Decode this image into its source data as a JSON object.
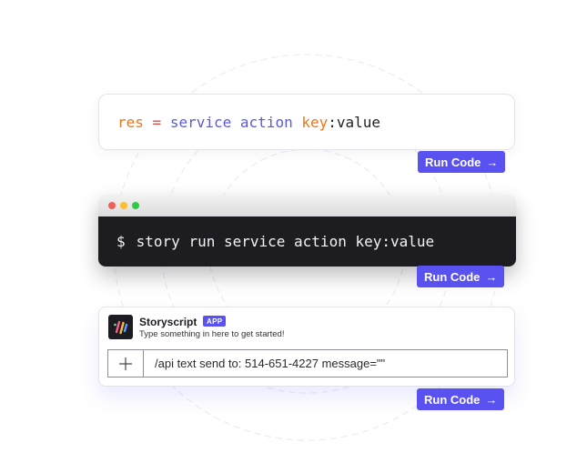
{
  "code_snippet": {
    "variable": "res",
    "operator": "=",
    "service": "service",
    "action": "action",
    "key": "key",
    "colon": ":",
    "value": "value"
  },
  "terminal": {
    "prompt": "$",
    "command": "story run service action key:value",
    "window_dots": [
      "red",
      "yellow",
      "green"
    ]
  },
  "chat": {
    "app_name": "Storyscript",
    "badge": "APP",
    "subtitle": "Type something in here to get started!",
    "input_value": "/api text send to: 514-651-4227 message=\"\"",
    "attach_icon": "plus-icon"
  },
  "run_buttons": [
    {
      "label": "Run Code",
      "icon": "arrow-right-icon"
    },
    {
      "label": "Run Code",
      "icon": "arrow-right-icon"
    },
    {
      "label": "Run Code",
      "icon": "arrow-right-icon"
    }
  ],
  "colors": {
    "accent": "#5a52f0",
    "terminal_bg": "#1d1d21",
    "syntax_orange": "#e8761c",
    "syntax_purple": "#5a58e0",
    "syntax_red": "#e24a4a"
  }
}
